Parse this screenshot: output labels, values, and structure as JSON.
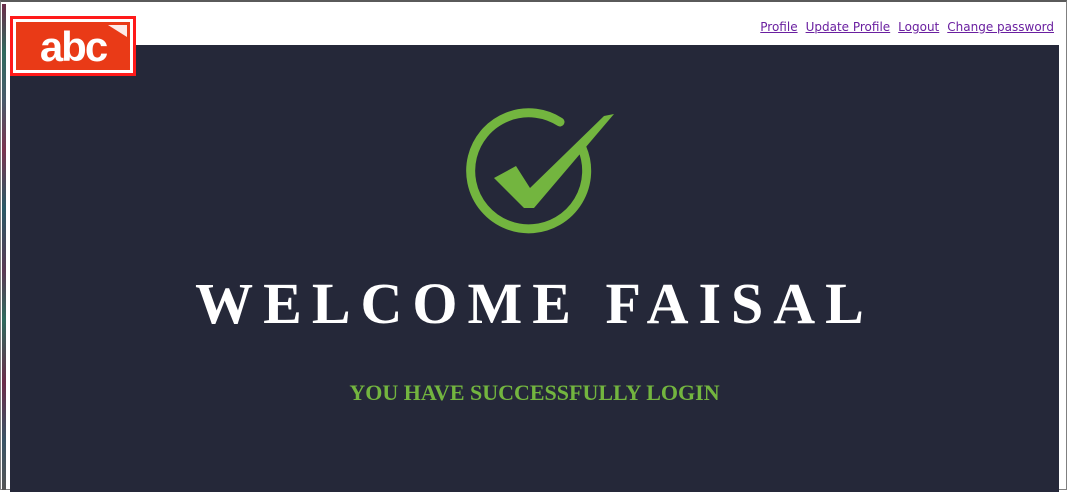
{
  "logo": {
    "text": "abc",
    "color": "#e93a17",
    "border_color": "#ff1a1a"
  },
  "nav": {
    "profile": "Profile",
    "update_profile": "Update Profile",
    "logout": "Logout",
    "change_password": "Change password"
  },
  "hero": {
    "background": "#252839",
    "icon": "check-circle-icon",
    "welcome": "WELCOME FAISAL",
    "subtitle": "YOU HAVE SUCCESSFULLY LOGIN",
    "accent": "#73b53f"
  }
}
